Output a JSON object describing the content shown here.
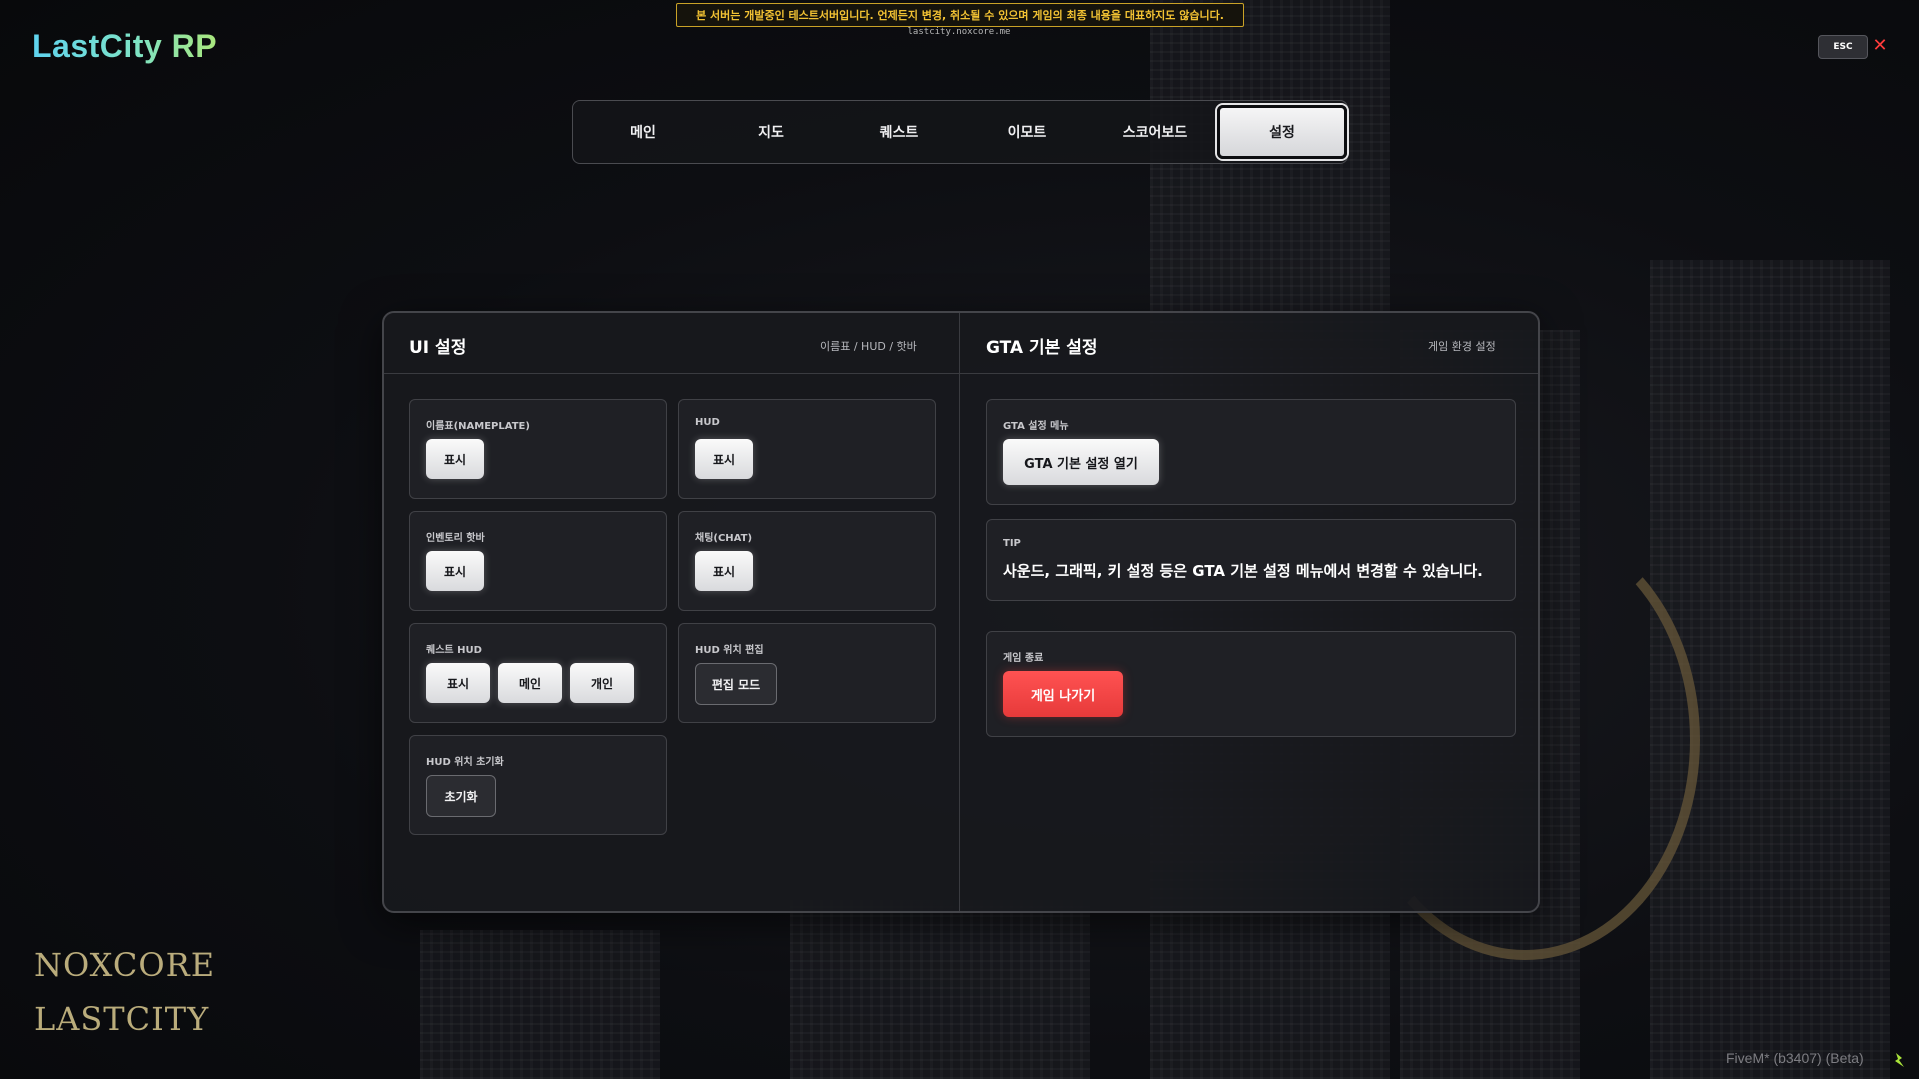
{
  "top_notice": {
    "text": "본 서버는 개발중인 테스트서버입니다. 언제든지 변경, 취소될 수 있으며 게임의 최종 내용을 대표하지도 않습니다.",
    "url": "lastcity.noxcore.me"
  },
  "logo": {
    "text": "LastCity RP"
  },
  "window_controls": {
    "esc_label": "ESC",
    "close_glyph": "✕"
  },
  "tabs": [
    {
      "label": "메인"
    },
    {
      "label": "지도"
    },
    {
      "label": "퀘스트"
    },
    {
      "label": "이모트"
    },
    {
      "label": "스코어보드"
    },
    {
      "label": "설정",
      "active": true
    }
  ],
  "ui_settings": {
    "title": "UI 설정",
    "subtitle": "이름표 / HUD / 핫바",
    "cards": {
      "nameplate": {
        "label": "이름표(NAMEPLATE)",
        "button": "표시"
      },
      "hud": {
        "label": "HUD",
        "button": "표시"
      },
      "hotbar": {
        "label": "인벤토리 핫바",
        "button": "표시"
      },
      "chat": {
        "label": "채팅(CHAT)",
        "button": "표시"
      },
      "quest_hud": {
        "label": "퀘스트 HUD",
        "buttons": [
          "표시",
          "메인",
          "개인"
        ]
      },
      "hud_position_edit": {
        "label": "HUD 위치 편집",
        "button": "편집 모드"
      },
      "hud_position_reset": {
        "label": "HUD 위치 초기화",
        "button": "초기화"
      }
    }
  },
  "gta_settings": {
    "title": "GTA 기본 설정",
    "subtitle": "게임 환경 설정",
    "menu_card": {
      "label": "GTA 설정 메뉴",
      "button": "GTA 기본 설정 열기"
    },
    "tip_card": {
      "label": "TIP",
      "text": "사운드, 그래픽, 키 설정 등은 GTA 기본 설정 메뉴에서 변경할 수 있습니다."
    },
    "exit_card": {
      "label": "게임 종료",
      "button": "게임 나가기"
    }
  },
  "bottom_branding": {
    "line1": "NOXCORE",
    "line2": "LASTCITY"
  },
  "client_info": {
    "text": "FiveM* (b3407) (Beta)"
  },
  "colors": {
    "accent_gold": "#f2c233",
    "danger_red": "#e73a3a",
    "logo_gradient": [
      "#5fd3f0",
      "#a9e67c"
    ]
  }
}
